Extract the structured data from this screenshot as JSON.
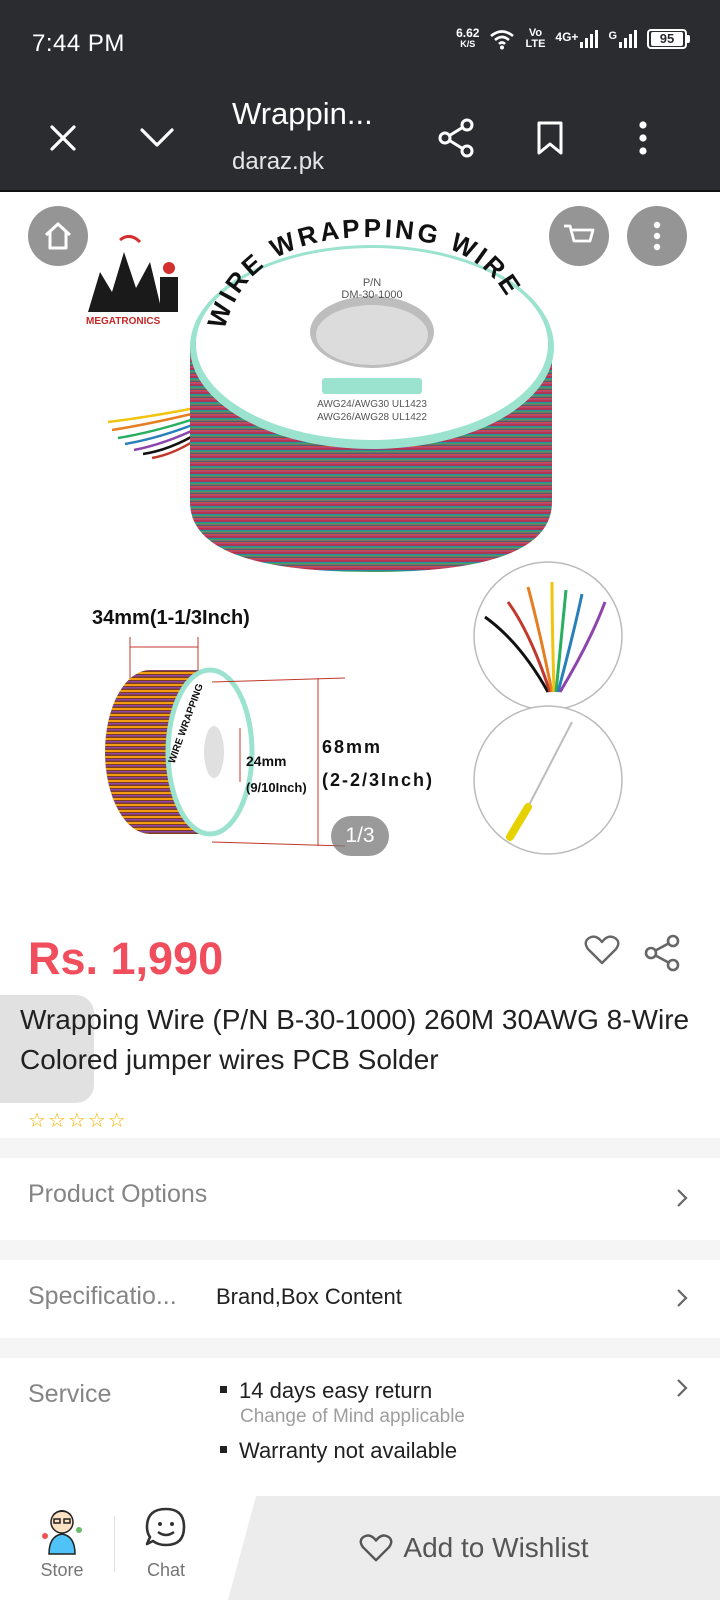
{
  "status_bar": {
    "time": "7:44 PM",
    "net_speed": "6.62",
    "net_unit": "K/S",
    "volte_1": "Vo",
    "volte_2": "LTE",
    "network": "4G+",
    "battery": "95"
  },
  "toolbar": {
    "title": "Wrappin...",
    "url": "daraz.pk",
    "icons": [
      "close-icon",
      "chevron-down-icon",
      "share-icon",
      "bookmark-icon",
      "more-vert-icon"
    ]
  },
  "gallery": {
    "page_indicator": "1/3",
    "brand_logo_text": "MEGATRONICS",
    "spool_label_1": "WIRE WRAPPING WIRE",
    "spool_label_2": "P/N",
    "spool_label_3": "DM-30-1000",
    "spool_label_4": "AWG24/AWG30   UL1423",
    "spool_label_5": "AWG26/AWG28   UL1422",
    "dim_width": "34mm(1-1/3Inch)",
    "dim_inner_1": "24mm",
    "dim_inner_2": "(9/10Inch)",
    "dim_height_1": "68mm",
    "dim_height_2": "(2-2/3Inch)"
  },
  "product": {
    "price": "Rs. 1,990",
    "title": "Wrapping Wire (P/N B-30-1000) 260M 30AWG 8-Wire Colored jumper wires PCB Solder",
    "rating_stars": 0
  },
  "rows": {
    "product_options": "Product Options",
    "specifications_label": "Specificatio...",
    "specifications_value": "Brand,Box Content",
    "service_label": "Service",
    "service_items": [
      {
        "title": "14 days easy return",
        "sub": "Change of Mind applicable"
      },
      {
        "title": "Warranty not available",
        "sub": ""
      }
    ]
  },
  "bottom_bar": {
    "store": "Store",
    "chat": "Chat",
    "wishlist": "Add to Wishlist"
  },
  "colors": {
    "price": "#f04d5d",
    "star": "#f4b400",
    "toolbar_bg": "#2b2c30"
  }
}
